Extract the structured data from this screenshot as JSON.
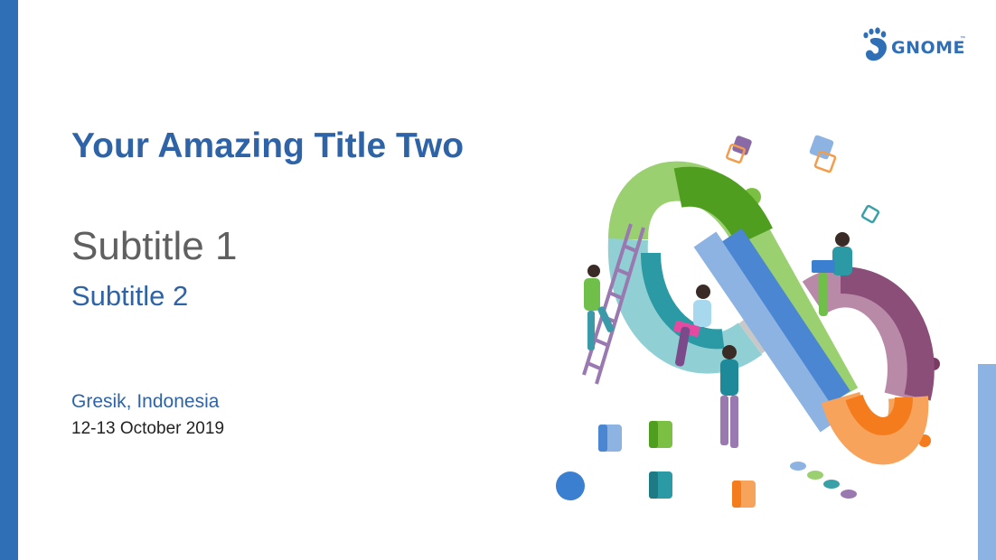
{
  "slide": {
    "title": "Your Amazing Title Two",
    "subtitle_1": "Subtitle 1",
    "subtitle_2": "Subtitle 2",
    "location": "Gresik, Indonesia",
    "date": "12-13 October 2019"
  },
  "logo": {
    "text": "GNOME",
    "trademark": "™",
    "icon": "gnome-foot-icon"
  },
  "illustration": {
    "subject": "people-on-infinity-loop"
  },
  "colors": {
    "accent_blue": "#2e6fb6",
    "title_blue": "#2e64a7",
    "light_blue_bar": "#8db3e2",
    "subtitle_gray": "#606060"
  }
}
